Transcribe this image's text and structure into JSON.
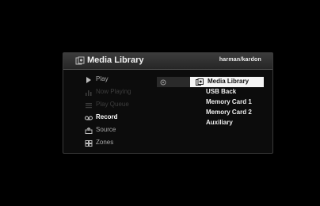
{
  "header": {
    "title": "Media Library",
    "brand": "harman/kardon",
    "icon": "media-library-icon"
  },
  "menu": {
    "items": [
      {
        "label": "Play",
        "icon": "play-icon",
        "state": "normal"
      },
      {
        "label": "Now Playing",
        "icon": "now-playing-icon",
        "state": "disabled"
      },
      {
        "label": "Play Queue",
        "icon": "play-queue-icon",
        "state": "disabled"
      },
      {
        "label": "Record",
        "icon": "record-icon",
        "state": "active"
      },
      {
        "label": "Source",
        "icon": "source-icon",
        "state": "normal"
      },
      {
        "label": "Zones",
        "icon": "zones-icon",
        "state": "normal"
      }
    ]
  },
  "submenu": {
    "items": [
      {
        "label": "Media Library",
        "selected": true
      },
      {
        "label": "USB Back",
        "selected": false
      },
      {
        "label": "Memory Card 1",
        "selected": false
      },
      {
        "label": "Memory Card 2",
        "selected": false
      },
      {
        "label": "Auxiliary",
        "selected": false
      }
    ]
  },
  "colors": {
    "background": "#000000",
    "panel": "#0c0c0c",
    "header": "#2e2e2e",
    "highlight": "#f4f4f4",
    "text": "#dddddd",
    "disabled_text": "#3e3e3e"
  }
}
